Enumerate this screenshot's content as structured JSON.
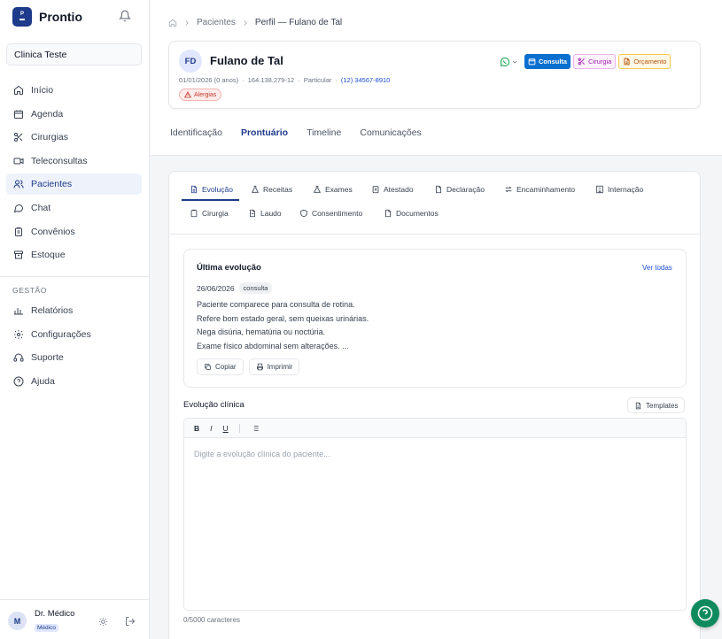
{
  "brand": {
    "name": "Prontio",
    "logo_text": "P"
  },
  "clinic": {
    "selected": "Clinica Teste"
  },
  "nav": {
    "items": [
      {
        "label": "Início",
        "icon": "home-icon"
      },
      {
        "label": "Agenda",
        "icon": "calendar-icon"
      },
      {
        "label": "Cirurgias",
        "icon": "scissors-icon"
      },
      {
        "label": "Teleconsultas",
        "icon": "video-icon"
      },
      {
        "label": "Pacientes",
        "icon": "users-icon",
        "active": true
      },
      {
        "label": "Chat",
        "icon": "chat-icon"
      },
      {
        "label": "Convênios",
        "icon": "clipboard-icon"
      },
      {
        "label": "Estoque",
        "icon": "archive-icon"
      }
    ],
    "section_label": "GESTÃO",
    "management": [
      {
        "label": "Relatórios",
        "icon": "bar-chart-icon"
      },
      {
        "label": "Configurações",
        "icon": "gear-icon"
      },
      {
        "label": "Suporte",
        "icon": "headset-icon"
      },
      {
        "label": "Ajuda",
        "icon": "help-circle-icon"
      }
    ]
  },
  "user": {
    "initial": "M",
    "name": "Dr. Médico",
    "role": "Médico"
  },
  "breadcrumb": {
    "items": [
      "Pacientes",
      "Perfil — Fulano de Tal"
    ]
  },
  "patient": {
    "initials": "FD",
    "name": "Fulano de Tal",
    "birth": "01/01/2026 (0 anos)",
    "cpf": "164.138.279-12",
    "plan": "Particular",
    "phone": "(12) 34567-8910",
    "allergy_label": "Alergias"
  },
  "actions": {
    "consulta": "Consulta",
    "cirurgia": "Cirurgia",
    "orcamento": "Orçamento"
  },
  "main_tabs": [
    "Identificação",
    "Prontuário",
    "Timeline",
    "Comunicações"
  ],
  "sub_tabs": {
    "evolucao": "Evolução",
    "receitas": "Receitas",
    "exames": "Exames",
    "atestado": "Atestado",
    "declaracao": "Declaração",
    "encaminhamento": "Encaminhamento",
    "internacao": "Internação",
    "cirurgia": "Cirurgia",
    "laudo": "Laudo",
    "consentimento": "Consentimento",
    "documentos": "Documentos"
  },
  "last_evolution": {
    "title": "Última evolução",
    "view_all": "Ver todas",
    "date": "26/06/2026",
    "tag": "consulta",
    "lines": [
      "Paciente comparece para consulta de rotina.",
      "Refere bom estado geral, sem queixas urinárias.",
      "Nega disúria, hematúria ou noctúria.",
      "Exame físico abdominal sem alterações. ..."
    ],
    "copy_label": "Copiar",
    "print_label": "Imprimir"
  },
  "clinical": {
    "label": "Evolução clínica",
    "templates_label": "Templates",
    "toolbar": {
      "bold": "B",
      "italic": "I",
      "underline": "U"
    },
    "placeholder": "Digite a evolução clínica do paciente...",
    "char_count": "0/5000 caracteres"
  },
  "colors": {
    "primary": "#1e3a8a",
    "consulta": "#0b6fd0",
    "help": "#0f8a5f"
  }
}
